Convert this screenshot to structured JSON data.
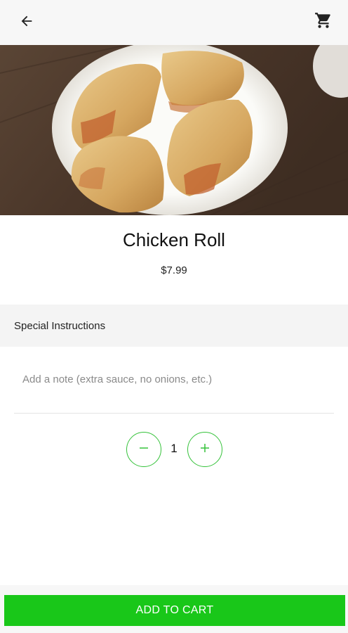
{
  "appbar": {
    "back_icon": "arrow-back-icon",
    "cart_icon": "shopping-cart-icon"
  },
  "item": {
    "name": "Chicken Roll",
    "price": "$7.99",
    "image": "chicken-roll-photo"
  },
  "instructions": {
    "header": "Special Instructions",
    "placeholder": "Add a note (extra sauce, no onions, etc.)",
    "value": ""
  },
  "quantity": {
    "value": "1",
    "minus_icon": "minus-icon",
    "plus_icon": "plus-icon"
  },
  "cta": {
    "label": "ADD TO CART"
  },
  "colors": {
    "accent": "#19c719",
    "stepper_border": "#35c23a",
    "section_bg": "#f4f4f4"
  }
}
